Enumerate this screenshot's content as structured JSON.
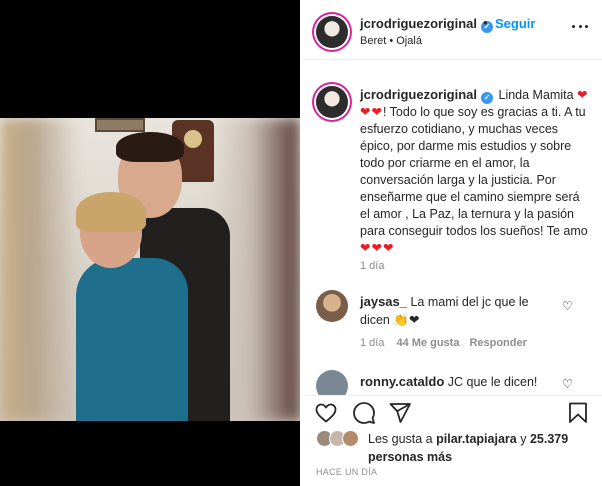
{
  "post": {
    "username": "jcrodriguezoriginal",
    "follow_label": "Seguir",
    "separator": "•",
    "audio": "Beret • Ojalá"
  },
  "caption": {
    "username": "jcrodriguezoriginal",
    "text_before_hearts": "Linda Mamita",
    "hearts_1": "❤❤❤",
    "text_main": "! Todo lo que soy es gracias a ti. A tu esfuerzo cotidiano, y muchas veces épico, por darme mis estudios y sobre todo por criarme en el amor, la conversación larga y la justicia. Por enseñarme que el camino siempre será el amor , La Paz, la ternura y la pasión para conseguir todos los sueños! Te amo",
    "hearts_2": "❤❤❤",
    "time": "1 día"
  },
  "comments": [
    {
      "username": "jaysas_",
      "text": "La mami del jc que le dicen",
      "emoji": "👏❤",
      "time": "1 día",
      "likes": "44 Me gusta",
      "reply": "Responder"
    },
    {
      "username": "ronny.cataldo",
      "text": "JC que le dicen!",
      "emoji": ""
    }
  ],
  "likes": {
    "prefix": "Les gusta a",
    "user": "pilar.tapiajara",
    "connector": "y",
    "count": "25.379 personas más"
  },
  "posted_ago": "HACE UN DÍA",
  "icons": {
    "verified": "verified-badge-icon",
    "more": "more-options-icon",
    "like": "heart-icon",
    "comment": "comment-icon",
    "share": "share-icon",
    "save": "bookmark-icon"
  },
  "colors": {
    "link_blue": "#0095f6",
    "verified_blue": "#3897f0",
    "heart_red": "#ed1c24",
    "muted": "#8e8e8e"
  }
}
